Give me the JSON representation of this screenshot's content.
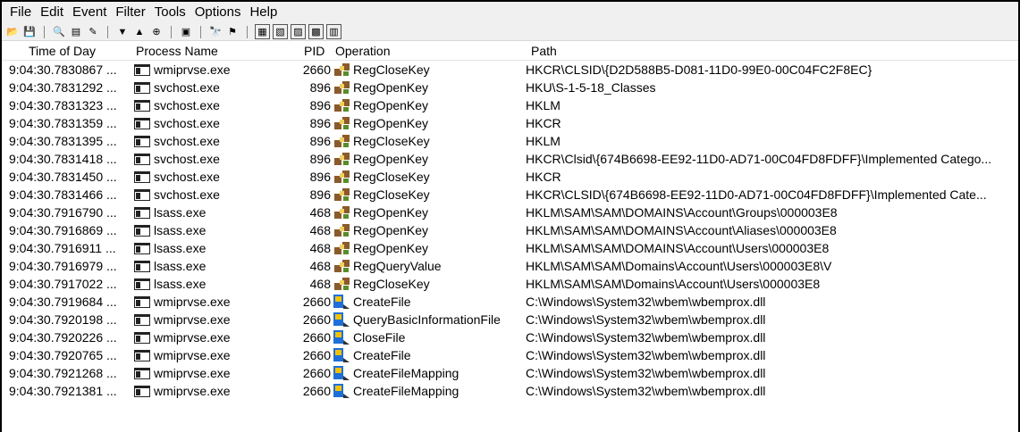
{
  "menu": [
    "File",
    "Edit",
    "Event",
    "Filter",
    "Tools",
    "Options",
    "Help"
  ],
  "toolbar": {
    "buttons": [
      {
        "name": "open-icon",
        "glyph": "📂"
      },
      {
        "name": "save-icon",
        "glyph": "💾"
      },
      {
        "sep": true
      },
      {
        "name": "magnifier-icon",
        "glyph": "🔍"
      },
      {
        "name": "autoscroll-icon",
        "glyph": "▤"
      },
      {
        "name": "clear-icon",
        "glyph": "✎"
      },
      {
        "sep": true
      },
      {
        "name": "filter-icon",
        "glyph": "▼"
      },
      {
        "name": "highlight-icon",
        "glyph": "▲"
      },
      {
        "name": "target-icon",
        "glyph": "⊕"
      },
      {
        "sep": true
      },
      {
        "name": "process-tree-icon",
        "glyph": "▣"
      },
      {
        "sep": true
      },
      {
        "name": "find-icon",
        "glyph": "🔭"
      },
      {
        "name": "jump-icon",
        "glyph": "⚑"
      },
      {
        "sep": true
      },
      {
        "name": "registry-activity-icon",
        "glyph": "▦",
        "boxed": true
      },
      {
        "name": "file-activity-icon",
        "glyph": "▧",
        "boxed": true
      },
      {
        "name": "network-activity-icon",
        "glyph": "▨",
        "boxed": true
      },
      {
        "name": "process-activity-icon",
        "glyph": "▩",
        "boxed": true
      },
      {
        "name": "profiling-activity-icon",
        "glyph": "▥",
        "boxed": true
      }
    ]
  },
  "columns": {
    "time": "Time of Day",
    "process": "Process Name",
    "pid": "PID",
    "operation": "Operation",
    "path": "Path"
  },
  "colors": {
    "registry_icon": "#8b5a2b",
    "file_icon": "#1e6fd9",
    "file_icon_accent": "#f2c200"
  },
  "rows": [
    {
      "time": "9:04:30.7830867 ...",
      "process": "wmiprvse.exe",
      "pid": "2660",
      "type": "registry",
      "operation": "RegCloseKey",
      "path": "HKCR\\CLSID\\{D2D588B5-D081-11D0-99E0-00C04FC2F8EC}"
    },
    {
      "time": "9:04:30.7831292 ...",
      "process": "svchost.exe",
      "pid": "896",
      "type": "registry",
      "operation": "RegOpenKey",
      "path": "HKU\\S-1-5-18_Classes"
    },
    {
      "time": "9:04:30.7831323 ...",
      "process": "svchost.exe",
      "pid": "896",
      "type": "registry",
      "operation": "RegOpenKey",
      "path": "HKLM"
    },
    {
      "time": "9:04:30.7831359 ...",
      "process": "svchost.exe",
      "pid": "896",
      "type": "registry",
      "operation": "RegOpenKey",
      "path": "HKCR"
    },
    {
      "time": "9:04:30.7831395 ...",
      "process": "svchost.exe",
      "pid": "896",
      "type": "registry",
      "operation": "RegCloseKey",
      "path": "HKLM"
    },
    {
      "time": "9:04:30.7831418 ...",
      "process": "svchost.exe",
      "pid": "896",
      "type": "registry",
      "operation": "RegOpenKey",
      "path": "HKCR\\Clsid\\{674B6698-EE92-11D0-AD71-00C04FD8FDFF}\\Implemented Catego..."
    },
    {
      "time": "9:04:30.7831450 ...",
      "process": "svchost.exe",
      "pid": "896",
      "type": "registry",
      "operation": "RegCloseKey",
      "path": "HKCR"
    },
    {
      "time": "9:04:30.7831466 ...",
      "process": "svchost.exe",
      "pid": "896",
      "type": "registry",
      "operation": "RegCloseKey",
      "path": "HKCR\\CLSID\\{674B6698-EE92-11D0-AD71-00C04FD8FDFF}\\Implemented Cate..."
    },
    {
      "time": "9:04:30.7916790 ...",
      "process": "lsass.exe",
      "pid": "468",
      "type": "registry",
      "operation": "RegOpenKey",
      "path": "HKLM\\SAM\\SAM\\DOMAINS\\Account\\Groups\\000003E8"
    },
    {
      "time": "9:04:30.7916869 ...",
      "process": "lsass.exe",
      "pid": "468",
      "type": "registry",
      "operation": "RegOpenKey",
      "path": "HKLM\\SAM\\SAM\\DOMAINS\\Account\\Aliases\\000003E8"
    },
    {
      "time": "9:04:30.7916911 ...",
      "process": "lsass.exe",
      "pid": "468",
      "type": "registry",
      "operation": "RegOpenKey",
      "path": "HKLM\\SAM\\SAM\\DOMAINS\\Account\\Users\\000003E8"
    },
    {
      "time": "9:04:30.7916979 ...",
      "process": "lsass.exe",
      "pid": "468",
      "type": "registry",
      "operation": "RegQueryValue",
      "path": "HKLM\\SAM\\SAM\\Domains\\Account\\Users\\000003E8\\V"
    },
    {
      "time": "9:04:30.7917022 ...",
      "process": "lsass.exe",
      "pid": "468",
      "type": "registry",
      "operation": "RegCloseKey",
      "path": "HKLM\\SAM\\SAM\\Domains\\Account\\Users\\000003E8"
    },
    {
      "time": "9:04:30.7919684 ...",
      "process": "wmiprvse.exe",
      "pid": "2660",
      "type": "file",
      "operation": "CreateFile",
      "path": "C:\\Windows\\System32\\wbem\\wbemprox.dll"
    },
    {
      "time": "9:04:30.7920198 ...",
      "process": "wmiprvse.exe",
      "pid": "2660",
      "type": "file",
      "operation": "QueryBasicInformationFile",
      "path": "C:\\Windows\\System32\\wbem\\wbemprox.dll"
    },
    {
      "time": "9:04:30.7920226 ...",
      "process": "wmiprvse.exe",
      "pid": "2660",
      "type": "file",
      "operation": "CloseFile",
      "path": "C:\\Windows\\System32\\wbem\\wbemprox.dll"
    },
    {
      "time": "9:04:30.7920765 ...",
      "process": "wmiprvse.exe",
      "pid": "2660",
      "type": "file",
      "operation": "CreateFile",
      "path": "C:\\Windows\\System32\\wbem\\wbemprox.dll"
    },
    {
      "time": "9:04:30.7921268 ...",
      "process": "wmiprvse.exe",
      "pid": "2660",
      "type": "file",
      "operation": "CreateFileMapping",
      "path": "C:\\Windows\\System32\\wbem\\wbemprox.dll"
    },
    {
      "time": "9:04:30.7921381 ...",
      "process": "wmiprvse.exe",
      "pid": "2660",
      "type": "file",
      "operation": "CreateFileMapping",
      "path": "C:\\Windows\\System32\\wbem\\wbemprox.dll"
    }
  ]
}
